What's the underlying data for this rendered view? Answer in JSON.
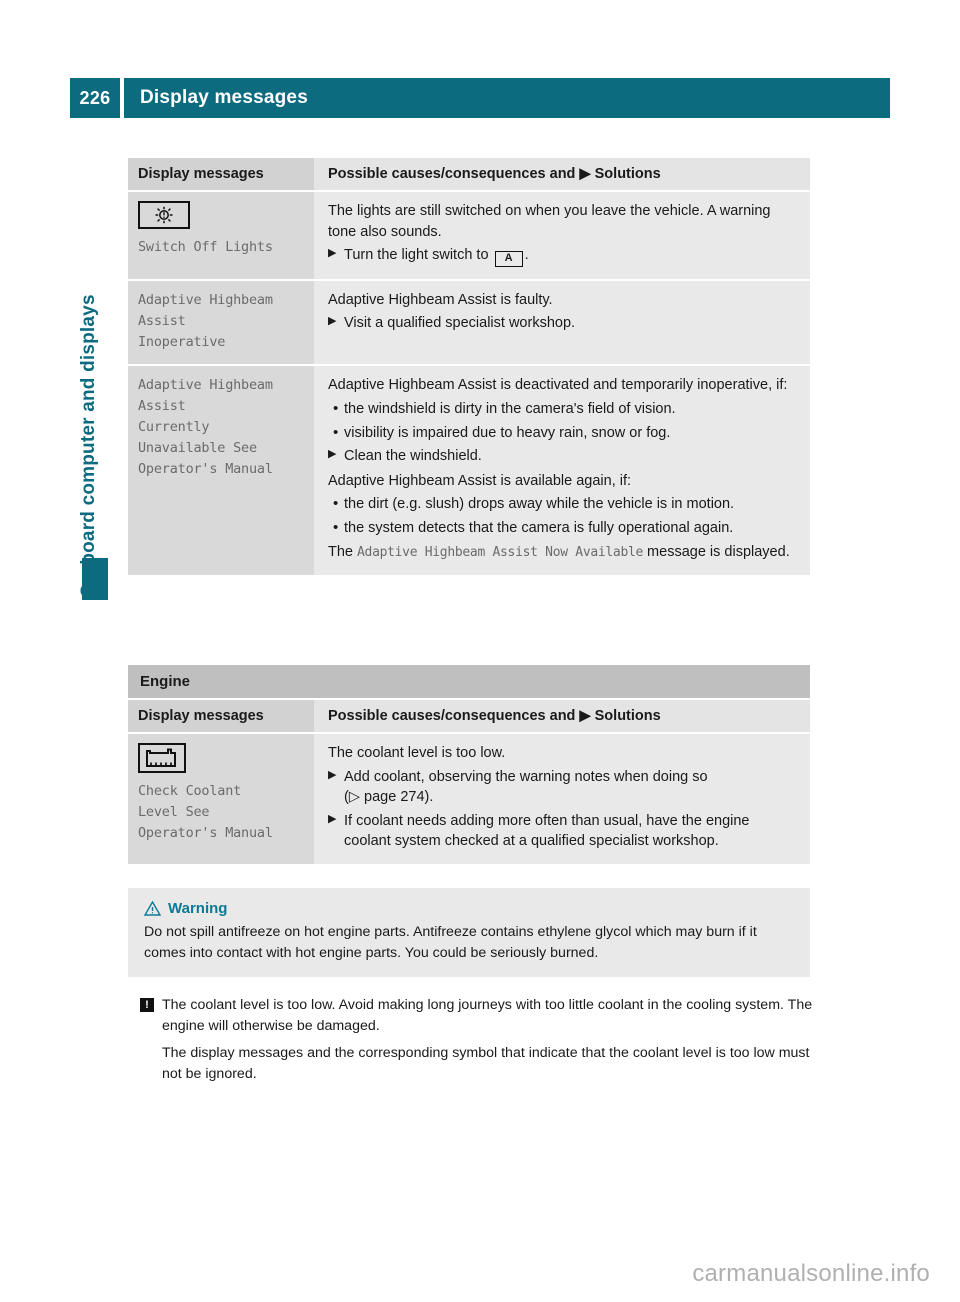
{
  "header": {
    "page_number": "226",
    "title": "Display messages"
  },
  "side_label": "On-board computer and displays",
  "table1": {
    "headers": {
      "left": "Display messages",
      "right_pre": "Possible causes/consequences and ",
      "right_marker": "▶",
      "right_post": " Solutions"
    },
    "rows": [
      {
        "icon": "lamp-icon",
        "message": "Switch Off Lights",
        "intro": "The lights are still switched on when you leave the vehicle. A warning tone also sounds.",
        "steps_pre": "Turn the light switch to ",
        "step_symbol": "A",
        "steps_post": "."
      },
      {
        "message": "Adaptive Highbeam\nAssist\nInoperative",
        "intro": "Adaptive Highbeam Assist is faulty.",
        "step": "Visit a qualified specialist workshop."
      },
      {
        "message": "Adaptive Highbeam\nAssist\nCurrently\nUnavailable See\nOperator's Manual",
        "intro": "Adaptive Highbeam Assist is deactivated and temporarily inoperative, if:",
        "bullets1": [
          "the windshield is dirty in the camera's field of vision.",
          "visibility is impaired due to heavy rain, snow or fog."
        ],
        "step": "Clean the windshield.",
        "mid": "Adaptive Highbeam Assist is available again, if:",
        "bullets2": [
          "the dirt (e.g. slush) drops away while the vehicle is in motion.",
          "the system detects that the camera is fully operational again."
        ],
        "outro_pre": "The ",
        "outro_mono": "Adaptive Highbeam Assist Now Available",
        "outro_post": " message is displayed."
      }
    ]
  },
  "table2": {
    "section_title": "Engine",
    "headers": {
      "left": "Display messages",
      "right_pre": "Possible causes/consequences and ",
      "right_marker": "▶",
      "right_post": " Solutions"
    },
    "row": {
      "icon": "coolant-level-icon",
      "message": "Check Coolant\nLevel See\nOperator's Manual",
      "intro": "The coolant level is too low.",
      "step1_line1": "Add coolant, observing the warning notes when doing so",
      "step1_line2_pre": "(",
      "step1_line2_marker": "▷",
      "step1_line2_post": " page 274).",
      "step2": "If coolant needs adding more often than usual, have the engine coolant system checked at a qualified specialist workshop."
    }
  },
  "warning": {
    "icon": "warning-triangle-icon",
    "label": "Warning",
    "body": "Do not spill antifreeze on hot engine parts. Antifreeze contains ethylene glycol which may burn if it comes into contact with hot engine parts. You could be seriously burned."
  },
  "note": {
    "marker": "!",
    "paragraph1": "The coolant level is too low. Avoid making long journeys with too little coolant in the cooling system. The engine will otherwise be damaged.",
    "paragraph2": "The display messages and the corresponding symbol that indicate that the coolant level is too low must not be ignored."
  },
  "footer": {
    "watermark": "carmanualsonline.info"
  },
  "colors": {
    "teal": "#0d6b80",
    "warning_teal": "#0d7a95",
    "col_left_bg": "#d9d9d9",
    "col_right_bg": "#e9e9e9",
    "section_band_bg": "#bfbfbf",
    "mono_text": "#6b6b6b"
  }
}
